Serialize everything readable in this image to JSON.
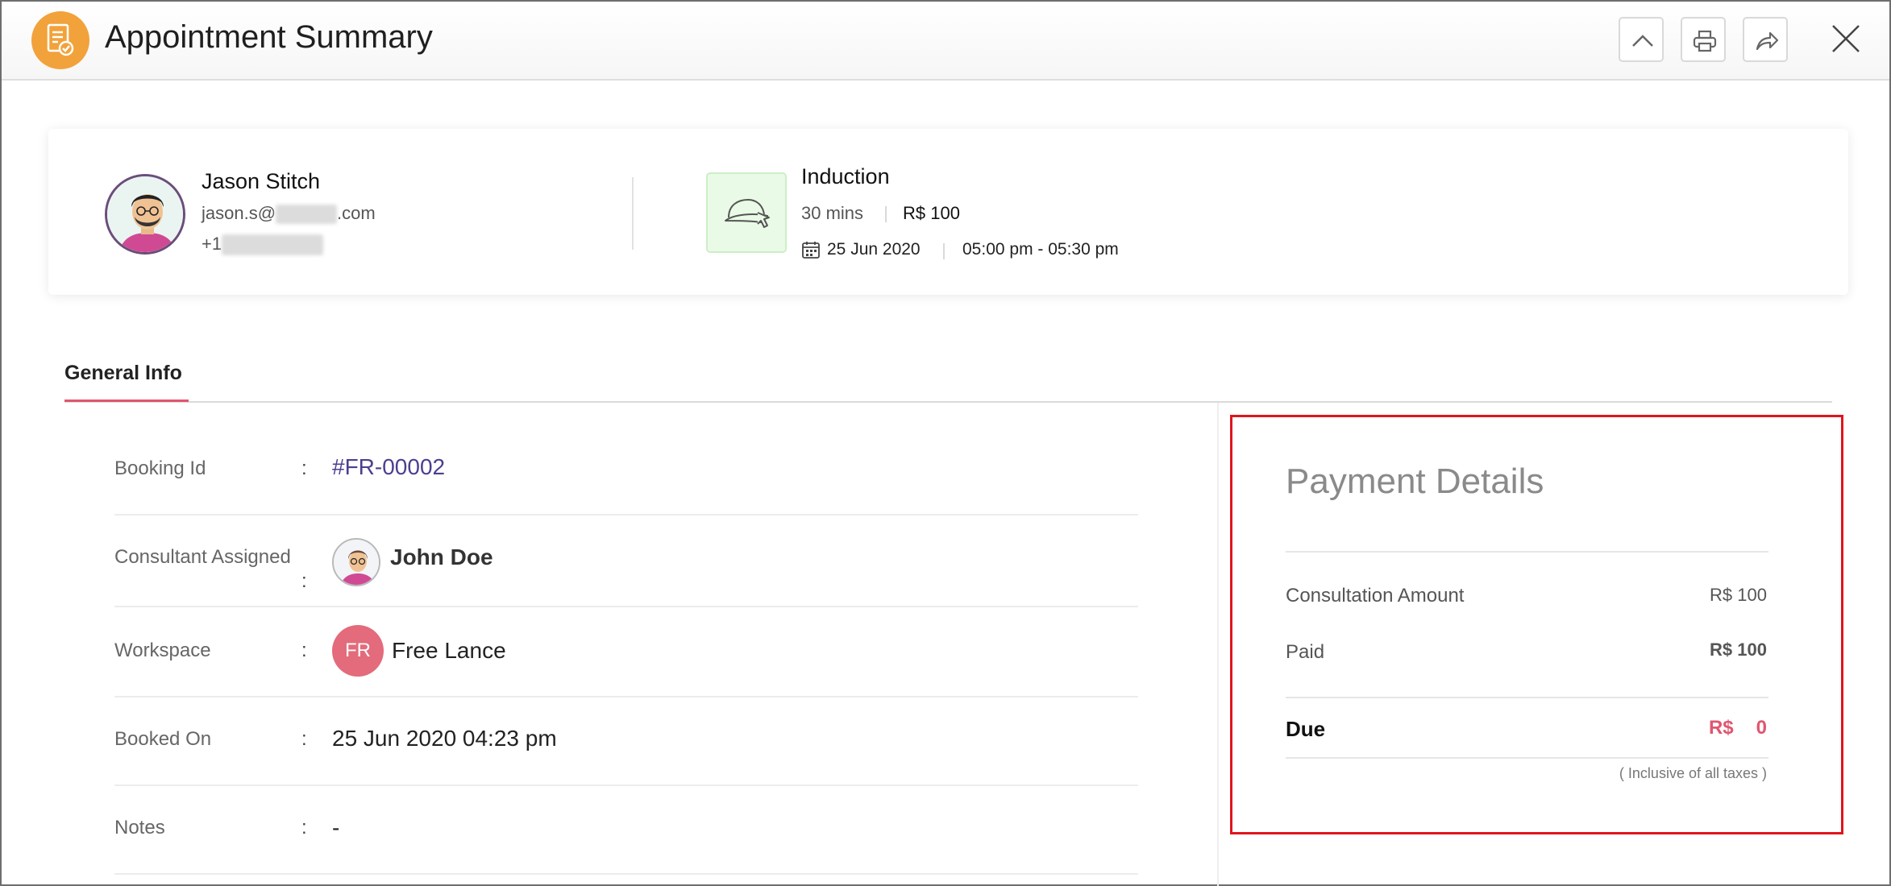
{
  "header": {
    "title": "Appointment Summary",
    "icons": [
      "document-check-icon",
      "chevron-up-icon",
      "printer-icon",
      "share-icon",
      "close-icon"
    ],
    "accent_color": "#f2a23a"
  },
  "customer": {
    "name": "Jason Stitch",
    "email_prefix": "jason.s@",
    "email_suffix": ".com",
    "phone_prefix": "+1"
  },
  "service": {
    "name": "Induction",
    "duration": "30 mins",
    "price": "R$ 100",
    "date": "25 Jun 2020",
    "time": "05:00 pm - 05:30 pm"
  },
  "tabs": [
    {
      "label": "General Info",
      "active": true
    }
  ],
  "general_info": {
    "booking_id": {
      "label": "Booking Id",
      "colon": ":",
      "value": "#FR-00002"
    },
    "consultant": {
      "label": "Consultant Assigned",
      "colon": ":",
      "value": "John Doe"
    },
    "workspace": {
      "label": "Workspace",
      "colon": ":",
      "initials": "FR",
      "value": "Free Lance"
    },
    "booked_on": {
      "label": "Booked On",
      "colon": ":",
      "value": "25 Jun 2020 04:23 pm"
    },
    "notes": {
      "label": "Notes",
      "colon": ":",
      "value": "-"
    }
  },
  "payment": {
    "title": "Payment Details",
    "consultation_amount": {
      "label": "Consultation Amount",
      "value": "R$ 100"
    },
    "paid": {
      "label": "Paid",
      "value": "R$ 100"
    },
    "due": {
      "label": "Due",
      "currency": "R$",
      "value": "0"
    },
    "tax_note": "( Inclusive of all taxes )",
    "due_color": "#e0566f",
    "highlight_color": "#e0141e"
  }
}
